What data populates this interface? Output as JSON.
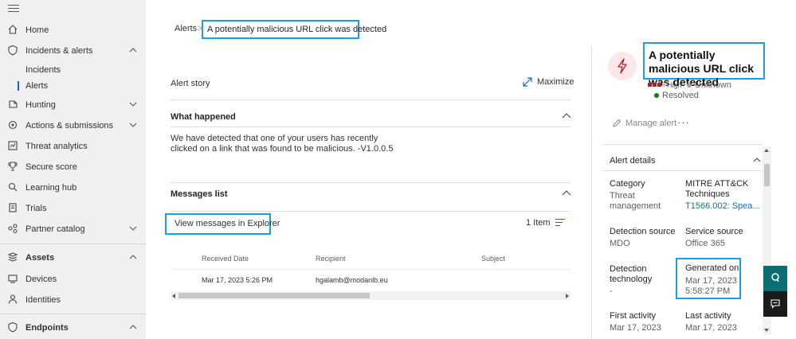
{
  "nav": {
    "items": [
      {
        "label": "Home",
        "icon": "home-icon"
      },
      {
        "label": "Incidents & alerts",
        "icon": "shield-icon"
      },
      {
        "label": "Incidents"
      },
      {
        "label": "Alerts"
      },
      {
        "label": "Hunting",
        "icon": "hunting-icon"
      },
      {
        "label": "Actions & submissions",
        "icon": "actions-icon"
      },
      {
        "label": "Threat analytics",
        "icon": "threat-analytics-icon"
      },
      {
        "label": "Secure score",
        "icon": "trophy-icon"
      },
      {
        "label": "Learning hub",
        "icon": "learning-hub-icon"
      },
      {
        "label": "Trials",
        "icon": "trials-icon"
      },
      {
        "label": "Partner catalog",
        "icon": "partner-catalog-icon"
      },
      {
        "label": "Assets",
        "icon": "assets-icon"
      },
      {
        "label": "Devices",
        "icon": "devices-icon"
      },
      {
        "label": "Identities",
        "icon": "identities-icon"
      },
      {
        "label": "Endpoints",
        "icon": "endpoints-icon"
      }
    ]
  },
  "breadcrumb": {
    "parent": "Alerts",
    "separator": ">",
    "current": "A potentially malicious URL click was detected"
  },
  "story": {
    "title": "Alert story",
    "maximize_label": "Maximize"
  },
  "what_happened": {
    "title": "What happened",
    "text": "We have detected that one of your users has recently clicked on a link that was found to be malicious. -V1.0.0.5"
  },
  "messages": {
    "title": "Messages list",
    "view_explorer": "View messages in Explorer",
    "item_count": "1 Item",
    "columns": [
      "Received Date",
      "Recipient",
      "Subject"
    ],
    "rows": [
      {
        "received": "Mar 17, 2023 5:26 PM",
        "recipient": "hgalamb@modanlb.eu",
        "subject": ""
      }
    ]
  },
  "panel": {
    "title": "A potentially malicious URL click was detected",
    "severity": "High",
    "severity_color": "#a4262c",
    "determination": "Unknown",
    "status": "Resolved",
    "status_color": "#107c10",
    "manage_label": "Manage alert",
    "more_label": "···",
    "details_title": "Alert details",
    "category_label": "Category",
    "category_value": "Threat management",
    "mitre_label": "MITRE ATT&CK Techniques",
    "mitre_value": "T1566.002: Spea...",
    "detection_source_label": "Detection source",
    "detection_source_value": "MDO",
    "service_source_label": "Service source",
    "service_source_value": "Office 365",
    "detection_tech_label": "Detection technology",
    "detection_tech_value": "-",
    "generated_label": "Generated on",
    "generated_value": "Mar 17, 2023 5:58:27 PM",
    "first_activity_label": "First activity",
    "first_activity_value": "Mar 17, 2023",
    "last_activity_label": "Last activity",
    "last_activity_value": "Mar 17, 2023"
  },
  "colors": {
    "accent": "#0f6cbd",
    "highlight_box": "#1a9fe0",
    "fab_help": "#0a6e72",
    "fab_feedback": "#1b1b1b"
  }
}
